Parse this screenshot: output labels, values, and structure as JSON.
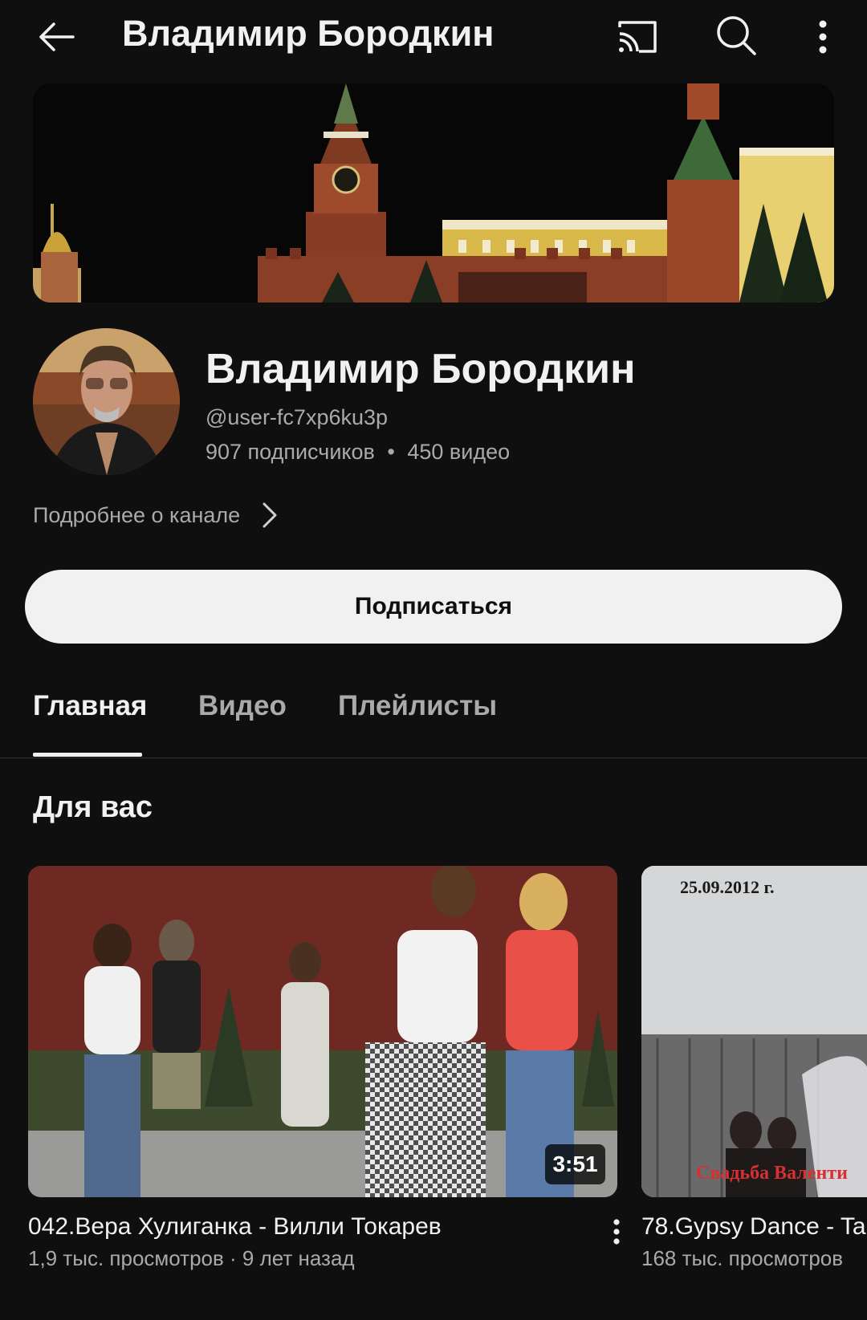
{
  "header": {
    "title": "Владимир Бородкин",
    "icons": [
      "back-arrow-icon",
      "cast-icon",
      "search-icon",
      "more-vert-icon"
    ]
  },
  "channel": {
    "name": "Владимир Бородкин",
    "handle": "@user-fc7xp6ku3p",
    "subscribers": "907 подписчиков",
    "stats_separator": "•",
    "videos_count": "450 видео",
    "about_link": "Подробнее о канале",
    "subscribe_label": "Подписаться"
  },
  "tabs": [
    {
      "label": "Главная",
      "active": true
    },
    {
      "label": "Видео",
      "active": false
    },
    {
      "label": "Плейлисты",
      "active": false
    }
  ],
  "section": {
    "title": "Для вас"
  },
  "videos": [
    {
      "title": "042.Вера Хулиганка - Вилли Токарев",
      "meta": "1,9 тыс. просмотров · 9 лет назад",
      "duration": "3:51"
    },
    {
      "title": "78.Gypsy Dance - Ta",
      "meta": "168 тыс. просмотров",
      "overlay_date": "25.09.2012 г.",
      "overlay_caption": "Свадьба Валенти"
    }
  ],
  "colors": {
    "background": "#0f0f0f",
    "text_primary": "#f1f1f1",
    "text_secondary": "#aaaaaa",
    "subscribe_bg": "#f1f1f1"
  }
}
